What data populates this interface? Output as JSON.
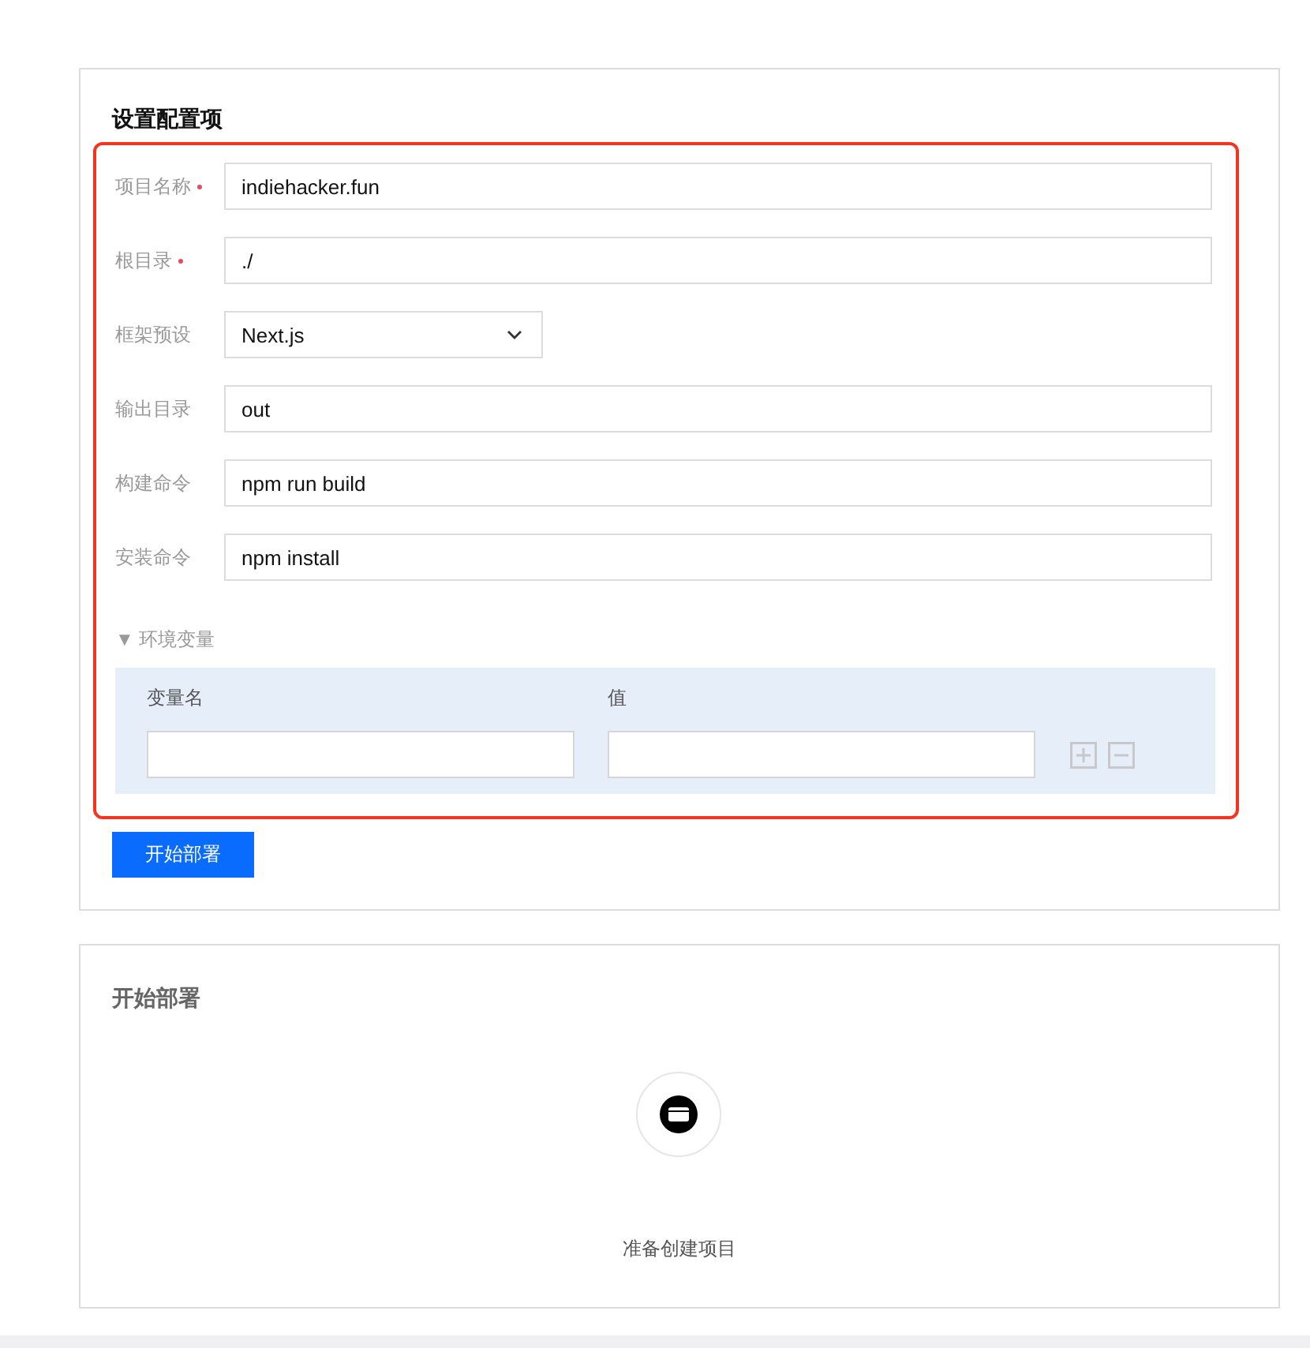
{
  "config": {
    "title": "设置配置项",
    "highlighted": true,
    "fields": [
      {
        "label": "项目名称",
        "required": true,
        "kind": "input",
        "value": "indiehacker.fun"
      },
      {
        "label": "根目录",
        "required": true,
        "kind": "input",
        "value": "./"
      },
      {
        "label": "框架预设",
        "required": false,
        "kind": "select",
        "value": "Next.js"
      },
      {
        "label": "输出目录",
        "required": false,
        "kind": "input",
        "value": "out"
      },
      {
        "label": "构建命令",
        "required": false,
        "kind": "input",
        "value": "npm run build"
      },
      {
        "label": "安装命令",
        "required": false,
        "kind": "input",
        "value": "npm install"
      }
    ],
    "env": {
      "toggle": "▼",
      "label": "环境变量",
      "expanded": true,
      "name_header": "变量名",
      "value_header": "值"
    },
    "submit": "开始部署"
  },
  "deploy": {
    "title": "开始部署",
    "status": "准备创建项目"
  }
}
